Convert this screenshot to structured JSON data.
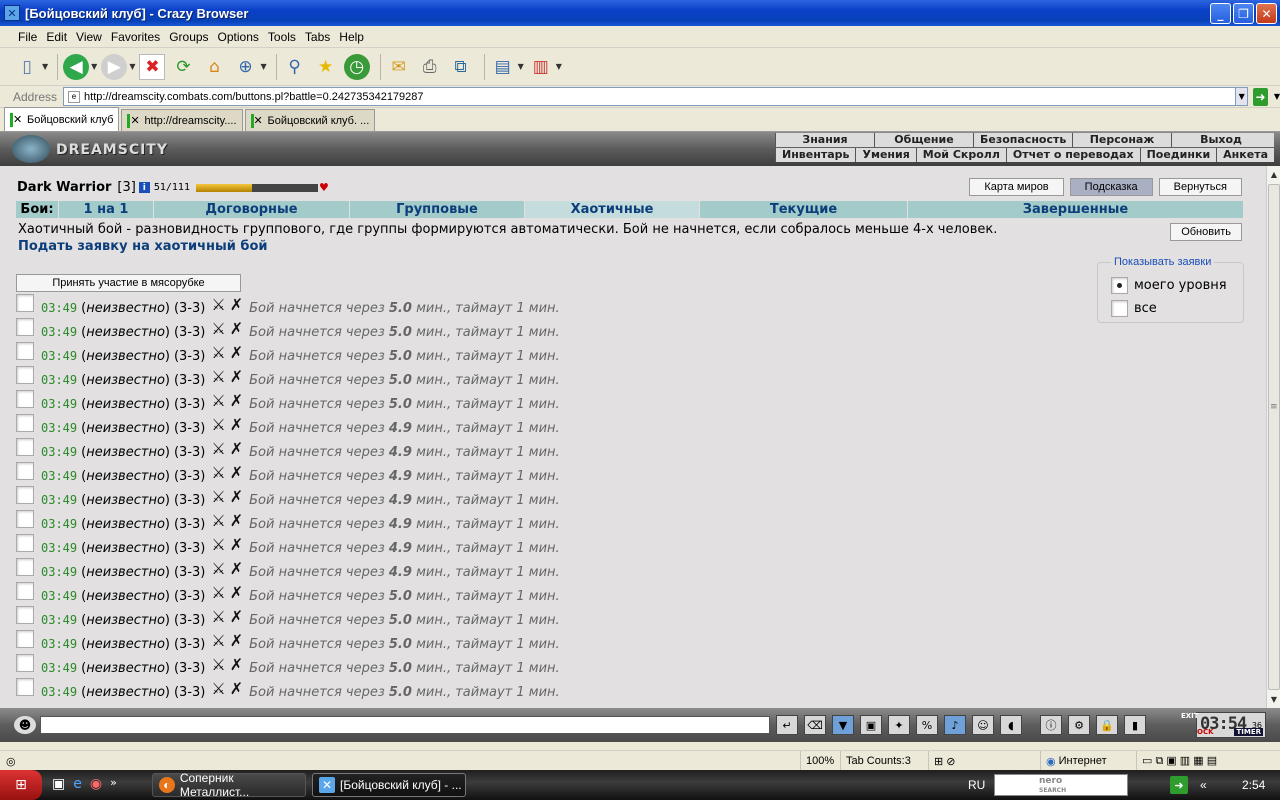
{
  "window": {
    "title": "[Бойцовский клуб] - Crazy Browser",
    "min": "_",
    "max": "❐",
    "close": "✕"
  },
  "menu": [
    "File",
    "Edit",
    "View",
    "Favorites",
    "Groups",
    "Options",
    "Tools",
    "Tabs",
    "Help"
  ],
  "address": {
    "label": "Address",
    "url": "http://dreamscity.combats.com/buttons.pl?battle=0.242735342179287"
  },
  "tabs": [
    "Бойцовский клуб",
    "http://dreamscity....",
    "Бойцовский клуб. ..."
  ],
  "game": {
    "brand": "DREAMSCITY",
    "nav_row1": [
      "Знания",
      "Общение",
      "Безопасность",
      "Персонаж",
      "Выход"
    ],
    "nav_row2": [
      "Инвентарь",
      "Умения",
      "Мой Скролл",
      "Отчет о переводах",
      "Поединки",
      "Анкета"
    ]
  },
  "player": {
    "name": "Dark Warrior",
    "level": "[3]",
    "info": "i",
    "hp": "51/111",
    "hp_fraction": 0.46
  },
  "top_buttons": [
    "Карта миров",
    "Подсказка",
    "Вернуться"
  ],
  "battle_tabs": {
    "label": "Бои:",
    "items": [
      "1 на 1",
      "Договорные",
      "Групповые",
      "Хаотичные",
      "Текущие",
      "Завершенные"
    ],
    "selected": 3
  },
  "description": "Хаотичный бой - разновидность группового, где группы формируются автоматически. Бой не начнется, если собралось меньше 4-х человек.",
  "apply_link": "Подать заявку на хаотичный бой",
  "refresh_button": "Обновить",
  "join_button": "Принять участие в мясорубке",
  "filter": {
    "legend": "Показывать заявки",
    "options": [
      "моего уровня",
      "все"
    ],
    "selected": 0
  },
  "requests": [
    {
      "time": "03:49",
      "who": "неизвестно",
      "team": "(3-3)",
      "status_pre": "Бой начнется через",
      "minutes": "5.0",
      "status_post": "мин., таймаут 1 мин."
    },
    {
      "time": "03:49",
      "who": "неизвестно",
      "team": "(3-3)",
      "status_pre": "Бой начнется через",
      "minutes": "5.0",
      "status_post": "мин., таймаут 1 мин."
    },
    {
      "time": "03:49",
      "who": "неизвестно",
      "team": "(3-3)",
      "status_pre": "Бой начнется через",
      "minutes": "5.0",
      "status_post": "мин., таймаут 1 мин."
    },
    {
      "time": "03:49",
      "who": "неизвестно",
      "team": "(3-3)",
      "status_pre": "Бой начнется через",
      "minutes": "5.0",
      "status_post": "мин., таймаут 1 мин."
    },
    {
      "time": "03:49",
      "who": "неизвестно",
      "team": "(3-3)",
      "status_pre": "Бой начнется через",
      "minutes": "5.0",
      "status_post": "мин., таймаут 1 мин."
    },
    {
      "time": "03:49",
      "who": "неизвестно",
      "team": "(3-3)",
      "status_pre": "Бой начнется через",
      "minutes": "4.9",
      "status_post": "мин., таймаут 1 мин."
    },
    {
      "time": "03:49",
      "who": "неизвестно",
      "team": "(3-3)",
      "status_pre": "Бой начнется через",
      "minutes": "4.9",
      "status_post": "мин., таймаут 1 мин."
    },
    {
      "time": "03:49",
      "who": "неизвестно",
      "team": "(3-3)",
      "status_pre": "Бой начнется через",
      "minutes": "4.9",
      "status_post": "мин., таймаут 1 мин."
    },
    {
      "time": "03:49",
      "who": "неизвестно",
      "team": "(3-3)",
      "status_pre": "Бой начнется через",
      "minutes": "4.9",
      "status_post": "мин., таймаут 1 мин."
    },
    {
      "time": "03:49",
      "who": "неизвестно",
      "team": "(3-3)",
      "status_pre": "Бой начнется через",
      "minutes": "4.9",
      "status_post": "мин., таймаут 1 мин."
    },
    {
      "time": "03:49",
      "who": "неизвестно",
      "team": "(3-3)",
      "status_pre": "Бой начнется через",
      "minutes": "4.9",
      "status_post": "мин., таймаут 1 мин."
    },
    {
      "time": "03:49",
      "who": "неизвестно",
      "team": "(3-3)",
      "status_pre": "Бой начнется через",
      "minutes": "4.9",
      "status_post": "мин., таймаут 1 мин."
    },
    {
      "time": "03:49",
      "who": "неизвестно",
      "team": "(3-3)",
      "status_pre": "Бой начнется через",
      "minutes": "5.0",
      "status_post": "мин., таймаут 1 мин."
    },
    {
      "time": "03:49",
      "who": "неизвестно",
      "team": "(3-3)",
      "status_pre": "Бой начнется через",
      "minutes": "5.0",
      "status_post": "мин., таймаут 1 мин."
    },
    {
      "time": "03:49",
      "who": "неизвестно",
      "team": "(3-3)",
      "status_pre": "Бой начнется через",
      "minutes": "5.0",
      "status_post": "мин., таймаут 1 мин."
    },
    {
      "time": "03:49",
      "who": "неизвестно",
      "team": "(3-3)",
      "status_pre": "Бой начнется через",
      "minutes": "5.0",
      "status_post": "мин., таймаут 1 мин."
    },
    {
      "time": "03:49",
      "who": "неизвестно",
      "team": "(3-3)",
      "status_pre": "Бой начнется через",
      "minutes": "5.0",
      "status_post": "мин., таймаут 1 мин."
    }
  ],
  "chat": {
    "clock": "03:54",
    "seconds": "36",
    "timer": "TIMER",
    "exit": "EXIT",
    "ock": "OCK"
  },
  "status": {
    "zoom": "100%",
    "tab_count": "Tab Counts:3",
    "zone": "Интернет"
  },
  "taskbar": {
    "tasks": [
      "Соперник Металлист...",
      "[Бойцовский клуб] - ..."
    ],
    "lang": "RU",
    "search_brand": "nero",
    "search_sub": "SEARCH",
    "time": "2:54"
  },
  "colors": {
    "link": "#0b3e7a",
    "time_green": "#2a8a2a",
    "tab_bg": "#a3cbc9",
    "content_bg": "#e2e0e0"
  }
}
